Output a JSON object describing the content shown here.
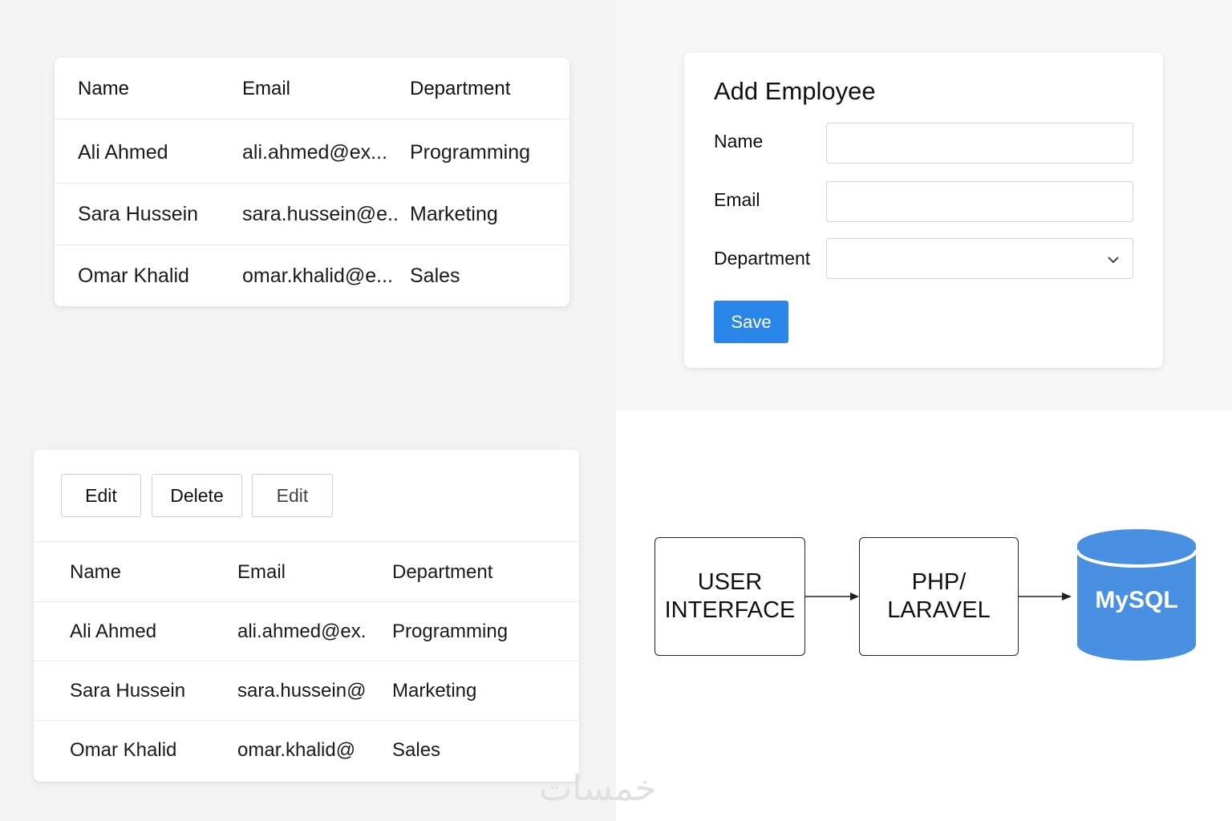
{
  "employee_list": {
    "headers": [
      "Name",
      "Email",
      "Department"
    ],
    "rows": [
      [
        "Ali Ahmed",
        "ali.ahmed@ex...",
        "Programming"
      ],
      [
        "Sara Hussein",
        "sara.hussein@e...",
        "Marketing"
      ],
      [
        "Omar Khalid",
        "omar.khalid@e...",
        "Sales"
      ]
    ]
  },
  "add_employee_form": {
    "title": "Add Employee",
    "name_label": "Name",
    "name_value": "",
    "email_label": "Email",
    "email_value": "",
    "department_label": "Department",
    "department_value": "",
    "save_label": "Save",
    "save_color": "#2b86ea",
    "chevron_icon": "chevron-down-icon"
  },
  "manage_table": {
    "toolbar": [
      "Edit",
      "Delete",
      "Edit"
    ],
    "headers": [
      "Name",
      "Email",
      "Department"
    ],
    "rows": [
      [
        "Ali Ahmed",
        "ali.ahmed@ex.",
        "Programming"
      ],
      [
        "Sara Hussein",
        "sara.hussein@",
        "Marketing"
      ],
      [
        "Omar Khalid",
        "omar.khalid@",
        "Sales"
      ]
    ]
  },
  "architecture": {
    "ui_box": "USER\nINTERFACE",
    "backend_box": "PHP/\nLARAVEL",
    "database": "MySQL",
    "database_color": "#4a90e2",
    "database_icon": "database-cylinder-icon"
  },
  "watermark": "خمسات"
}
